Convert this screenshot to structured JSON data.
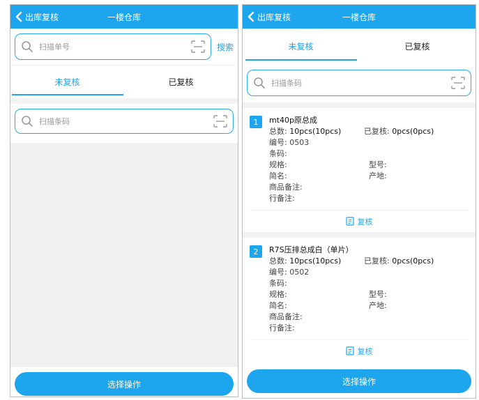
{
  "left": {
    "header": {
      "back_label": "出库复核",
      "title": "一楼仓库"
    },
    "order_search": {
      "placeholder": "扫描单号",
      "button_label": "搜索"
    },
    "tabs": [
      {
        "label": "未复核"
      },
      {
        "label": "已复核"
      }
    ],
    "barcode_search": {
      "placeholder": "扫描条码"
    },
    "bottom_button": "选择操作"
  },
  "right": {
    "header": {
      "back_label": "出库复核",
      "title": "一楼仓库"
    },
    "tabs": [
      {
        "label": "未复核"
      },
      {
        "label": "已复核"
      }
    ],
    "barcode_search": {
      "placeholder": "扫描条码"
    },
    "items": [
      {
        "index": "1",
        "name": "mt40p原总成",
        "total_label": "总数:",
        "total_value": "10pcs(10pcs)",
        "checked_label": "已复核:",
        "checked_value": "0pcs(0pcs)",
        "code_label": "编号:",
        "code_value": "0503",
        "barcode_label": "条码:",
        "spec_label": "规格:",
        "model_label": "型号:",
        "short_label": "简名:",
        "origin_label": "产地:",
        "goods_note_label": "商品备注:",
        "line_note_label": "行备注:",
        "action_label": "复核"
      },
      {
        "index": "2",
        "name": "R7S压排总成白（单片）",
        "total_label": "总数:",
        "total_value": "10pcs(10pcs)",
        "checked_label": "已复核:",
        "checked_value": "0pcs(0pcs)",
        "code_label": "编号:",
        "code_value": "0502",
        "barcode_label": "条码:",
        "spec_label": "规格:",
        "model_label": "型号:",
        "short_label": "简名:",
        "origin_label": "产地:",
        "goods_note_label": "商品备注:",
        "line_note_label": "行备注:",
        "action_label": "复核"
      }
    ],
    "bottom_button": "选择操作"
  },
  "colors": {
    "primary": "#1da5ee",
    "background_gray": "#f1f1f1"
  },
  "icons": [
    "chevron-left-icon",
    "search-icon",
    "scan-icon",
    "document-icon"
  ]
}
